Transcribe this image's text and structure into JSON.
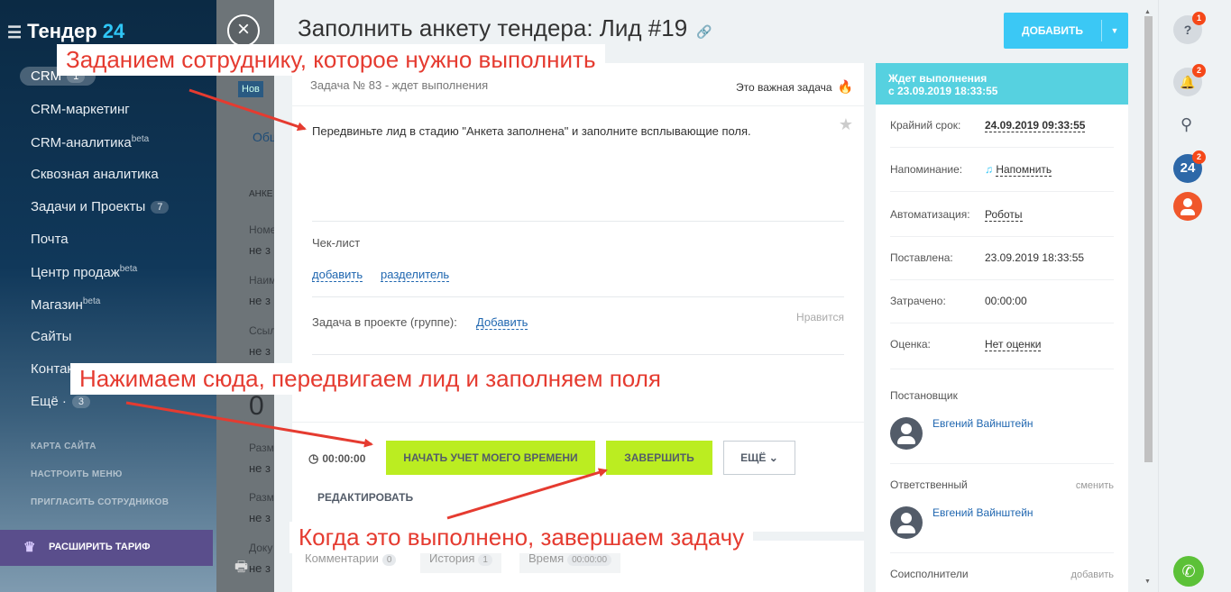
{
  "sidebar": {
    "logo_main": "Тендер",
    "logo_num": "24",
    "crm": {
      "label": "CRM",
      "count": "1"
    },
    "items": [
      {
        "label": "CRM-маркетинг",
        "sup": "",
        "count": ""
      },
      {
        "label": "CRM-аналитика",
        "sup": "beta",
        "count": ""
      },
      {
        "label": "Сквозная аналитика",
        "sup": "",
        "count": ""
      },
      {
        "label": "Задачи и Проекты",
        "sup": "",
        "count": "7"
      },
      {
        "label": "Почта",
        "sup": "",
        "count": ""
      },
      {
        "label": "Центр продаж",
        "sup": "beta",
        "count": ""
      },
      {
        "label": "Магазин",
        "sup": "beta",
        "count": ""
      },
      {
        "label": "Сайты",
        "sup": "",
        "count": ""
      },
      {
        "label": "Контакт-центр",
        "sup": "",
        "count": ""
      },
      {
        "label": "Ещё ·",
        "sup": "",
        "count": "3"
      }
    ],
    "small_links": [
      "КАРТА САЙТА",
      "НАСТРОИТЬ МЕНЮ",
      "ПРИГЛАСИТЬ СОТРУДНИКОВ"
    ],
    "tariff": "РАСШИРИТЬ ТАРИФ"
  },
  "background_page": {
    "fragments": [
      "Нов",
      "Общ",
      "АНКЕ",
      "Номе",
      "не з",
      "Наим",
      "не з",
      "Ссыл",
      "не з",
      "0",
      "Разм",
      "не з",
      "Разм",
      "не з",
      "Доку",
      "не з"
    ]
  },
  "slider": {
    "title": "Заполнить анкету тендера: Лид #19",
    "add_button": "ДОБАВИТЬ"
  },
  "task": {
    "number": "Задача № 83 - ждет выполнения",
    "important": "Это важная задача",
    "description": "Передвиньте лид в стадию \"Анкета заполнена\" и заполните всплывающие поля.",
    "checklist_title": "Чек-лист",
    "checklist_add": "добавить",
    "checklist_separator": "разделитель",
    "project_label": "Задача в проекте (группе):",
    "project_add": "Добавить",
    "like": "Нравится",
    "timer": "00:00:00",
    "start_button": "НАЧАТЬ УЧЕТ МОЕГО ВРЕМЕНИ",
    "finish_button": "ЗАВЕРШИТЬ",
    "more_button": "ЕЩЁ",
    "edit_button": "РЕДАКТИРОВАТЬ"
  },
  "tabs": [
    {
      "label": "Комментарии",
      "count": "0"
    },
    {
      "label": "История",
      "count": "1"
    },
    {
      "label": "Время",
      "count": "00:00:00"
    }
  ],
  "info": {
    "status_line1": "Ждет выполнения",
    "status_line2": "с 23.09.2019 18:33:55",
    "rows": [
      {
        "label": "Крайний срок:",
        "value": "24.09.2019 09:33:55"
      },
      {
        "label": "Напоминание:",
        "value": "Напомнить"
      },
      {
        "label": "Автоматизация:",
        "value": "Роботы"
      },
      {
        "label": "Поставлена:",
        "value": "23.09.2019 18:33:55"
      },
      {
        "label": "Затрачено:",
        "value": "00:00:00"
      },
      {
        "label": "Оценка:",
        "value": "Нет оценки"
      }
    ],
    "creator_title": "Постановщик",
    "creator_name": "Евгений Вайнштейн",
    "responsible_title": "Ответственный",
    "responsible_action": "сменить",
    "responsible_name": "Евгений Вайнштейн",
    "coexec_title": "Соисполнители",
    "coexec_action": "добавить"
  },
  "rail": {
    "help_badge": "1",
    "notif_badge": "2",
    "b24_label": "24",
    "b24_badge": "2"
  },
  "annotations": [
    "Заданием сотруднику, которое нужно выполнить",
    "Нажимаем сюда, передвигаем лид и заполняем поля",
    "Когда это выполнено, завершаем задачу"
  ],
  "colors": {
    "accent": "#3bc8f5",
    "green_button": "#bbed21",
    "status": "#56d1e0",
    "annotation": "#e53b30"
  }
}
